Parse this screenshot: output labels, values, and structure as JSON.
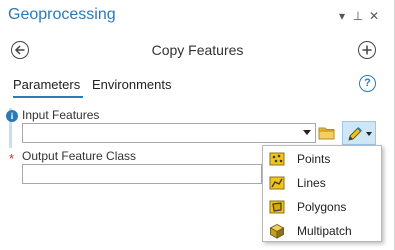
{
  "window": {
    "title": "Geoprocessing",
    "controls": {
      "menu": "▾",
      "pin": "⊥",
      "close": "✕"
    }
  },
  "tool": {
    "title": "Copy Features"
  },
  "tabs": [
    {
      "label": "Parameters",
      "active": true
    },
    {
      "label": "Environments",
      "active": false
    }
  ],
  "help": {
    "glyph": "?"
  },
  "fields": {
    "input_features": {
      "label": "Input Features",
      "value": ""
    },
    "output_feature_class": {
      "label": "Output Feature Class",
      "value": "",
      "required_marker": "*"
    }
  },
  "info_glyph": "i",
  "sketch_menu": {
    "items": [
      {
        "label": "Points",
        "icon": "points-icon"
      },
      {
        "label": "Lines",
        "icon": "lines-icon"
      },
      {
        "label": "Polygons",
        "icon": "polygons-icon"
      },
      {
        "label": "Multipatch",
        "icon": "multipatch-icon"
      }
    ]
  },
  "colors": {
    "accent": "#2a7ab8",
    "sketch_button_bg": "#cfe6f7",
    "required": "#c0392b",
    "icon_yellow": "#f0c419"
  }
}
